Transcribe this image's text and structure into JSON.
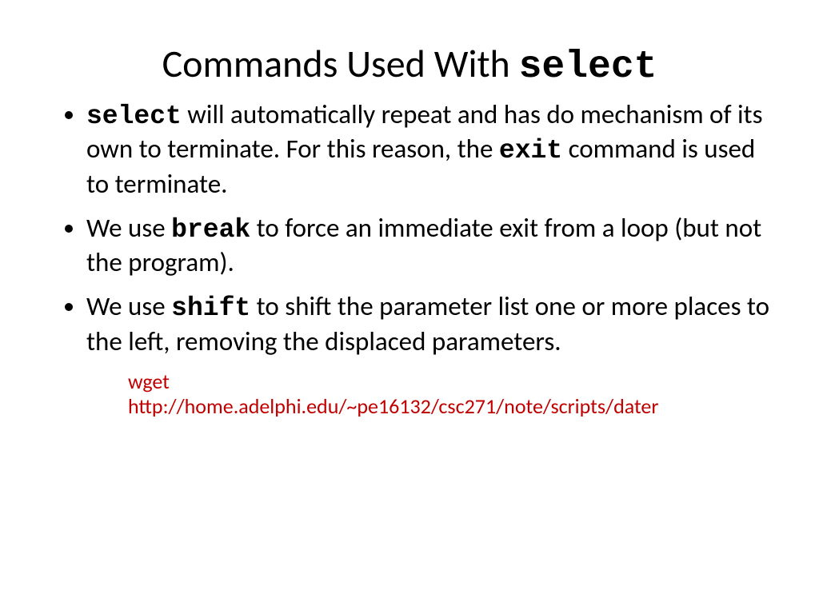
{
  "title": {
    "prefix": "Commands Used With ",
    "code": "select"
  },
  "bullets": [
    {
      "parts": [
        {
          "type": "code",
          "text": "select"
        },
        {
          "type": "text",
          "text": " will automatically repeat and has do mechanism of its own to terminate.  For this reason, the "
        },
        {
          "type": "code",
          "text": "exit"
        },
        {
          "type": "text",
          "text": " command is used to terminate."
        }
      ]
    },
    {
      "parts": [
        {
          "type": "text",
          "text": "We use "
        },
        {
          "type": "code",
          "text": "break"
        },
        {
          "type": "text",
          "text": " to force an immediate exit from a loop (but not the program)."
        }
      ]
    },
    {
      "parts": [
        {
          "type": "text",
          "text": "We use "
        },
        {
          "type": "code",
          "text": "shift"
        },
        {
          "type": "text",
          "text": " to shift the parameter list one or more places to the left, removing the displaced parameters."
        }
      ]
    }
  ],
  "note": {
    "line1": "wget",
    "line2": "http://home.adelphi.edu/~pe16132/csc271/note/scripts/dater"
  }
}
